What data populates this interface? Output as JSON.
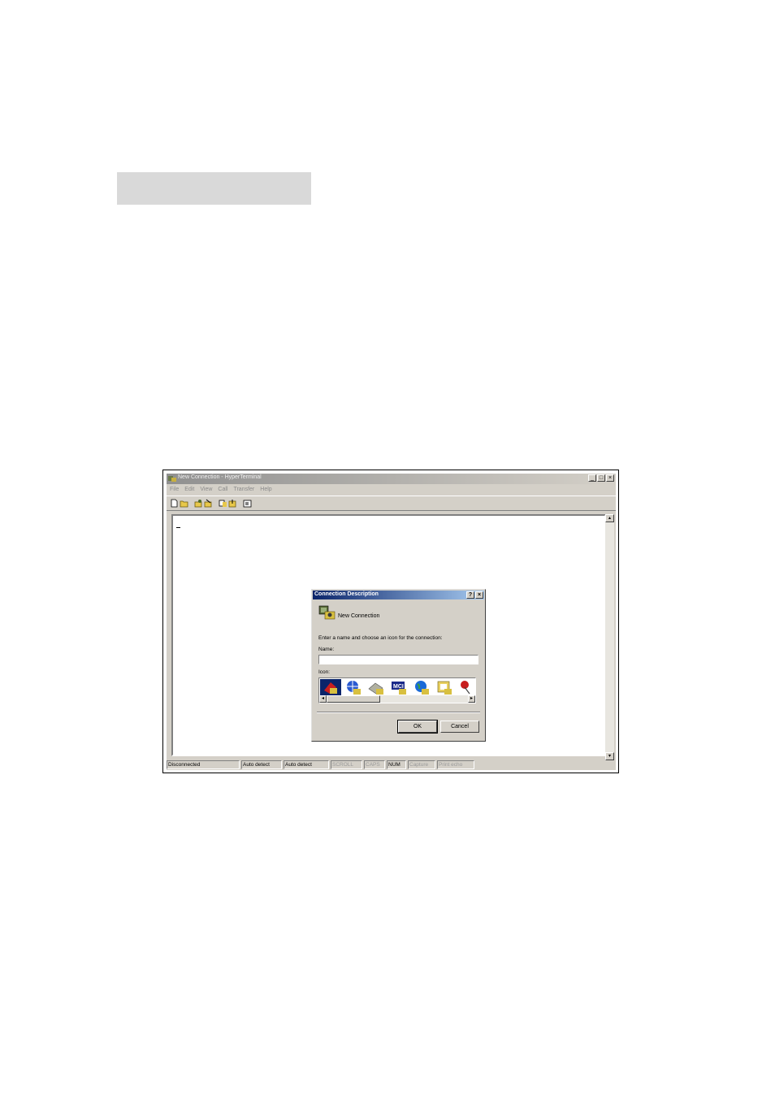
{
  "window": {
    "title": "New Connection - HyperTerminal",
    "menu": [
      "File",
      "Edit",
      "View",
      "Call",
      "Transfer",
      "Help"
    ],
    "controls": {
      "minimize": "_",
      "maximize": "□",
      "close": "×"
    },
    "toolbar_icons": [
      "new-icon",
      "open-icon",
      "dial-icon",
      "disconnect-icon",
      "send-icon",
      "receive-icon",
      "properties-icon"
    ]
  },
  "status_bar": {
    "cells": [
      "Disconnected",
      "Auto detect",
      "Auto detect",
      "SCROLL",
      "CAPS",
      "NUM",
      "Capture",
      "Print echo"
    ]
  },
  "dialog": {
    "title": "Connection Description",
    "help_button": "?",
    "close_button": "×",
    "heading": "New Connection",
    "prompt": "Enter a name and choose an icon for the connection:",
    "name_label": "Name:",
    "name_value": "",
    "icon_label": "Icon:",
    "icons": [
      "phone-icon",
      "globe-icon",
      "modem-icon",
      "mci-icon",
      "earth-icon",
      "folder-phone-icon",
      "pushpin-phone-icon"
    ],
    "ok_label": "OK",
    "cancel_label": "Cancel"
  },
  "colors": {
    "titlebar_active": "#0a246a",
    "face": "#d4d0c8"
  }
}
